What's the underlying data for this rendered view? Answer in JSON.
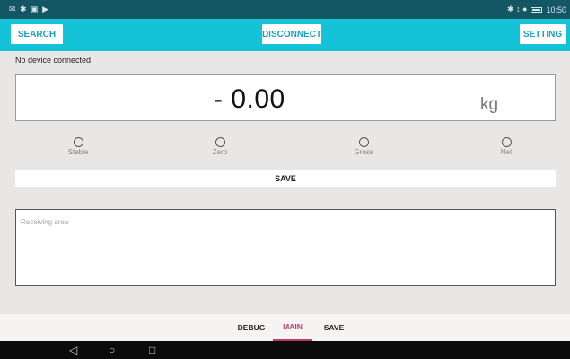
{
  "status_bar": {
    "left_icons": "✉ ✱ ▣ ▶",
    "right_icons": "✱ ↕ ●",
    "time": "10:50"
  },
  "toolbar": {
    "search_label": "SEARCH",
    "disconnect_label": "DISCONNECT",
    "setting_label": "SETTING",
    "color": "#14c3d7"
  },
  "connection_status": "No device connected",
  "weight": {
    "value": "- 0.00",
    "unit": "kg"
  },
  "indicators": [
    {
      "label": "Stable"
    },
    {
      "label": "Zero"
    },
    {
      "label": "Gross"
    },
    {
      "label": "Net"
    }
  ],
  "save_label": "SAVE",
  "receiving_area": {
    "placeholder": "Receiving area"
  },
  "bottom_nav": {
    "tabs": [
      {
        "label": "DEBUG"
      },
      {
        "label": "MAIN",
        "active": true
      },
      {
        "label": "SAVE"
      }
    ],
    "active_color": "#c0396c"
  },
  "system_nav": {
    "back_icon": "back-triangle-icon",
    "home_icon": "home-circle-icon",
    "recents_icon": "recents-square-icon"
  }
}
